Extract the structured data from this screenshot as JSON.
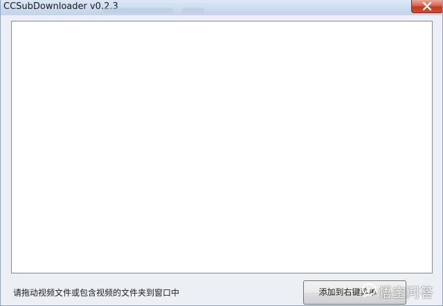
{
  "window": {
    "title": "CCSubDownloader v0.2.3"
  },
  "titlebar": {
    "close_icon": "close-icon",
    "close_color": "#c7402a"
  },
  "drop_area": {
    "background": "#ffffff"
  },
  "status": {
    "text": "请拖动视频文件或包含视频的文件夹到窗口中"
  },
  "action_button": {
    "label": "添加到右键菜单"
  },
  "watermark": {
    "icon": "chat-bubble-icon",
    "text": "悟空问答"
  }
}
